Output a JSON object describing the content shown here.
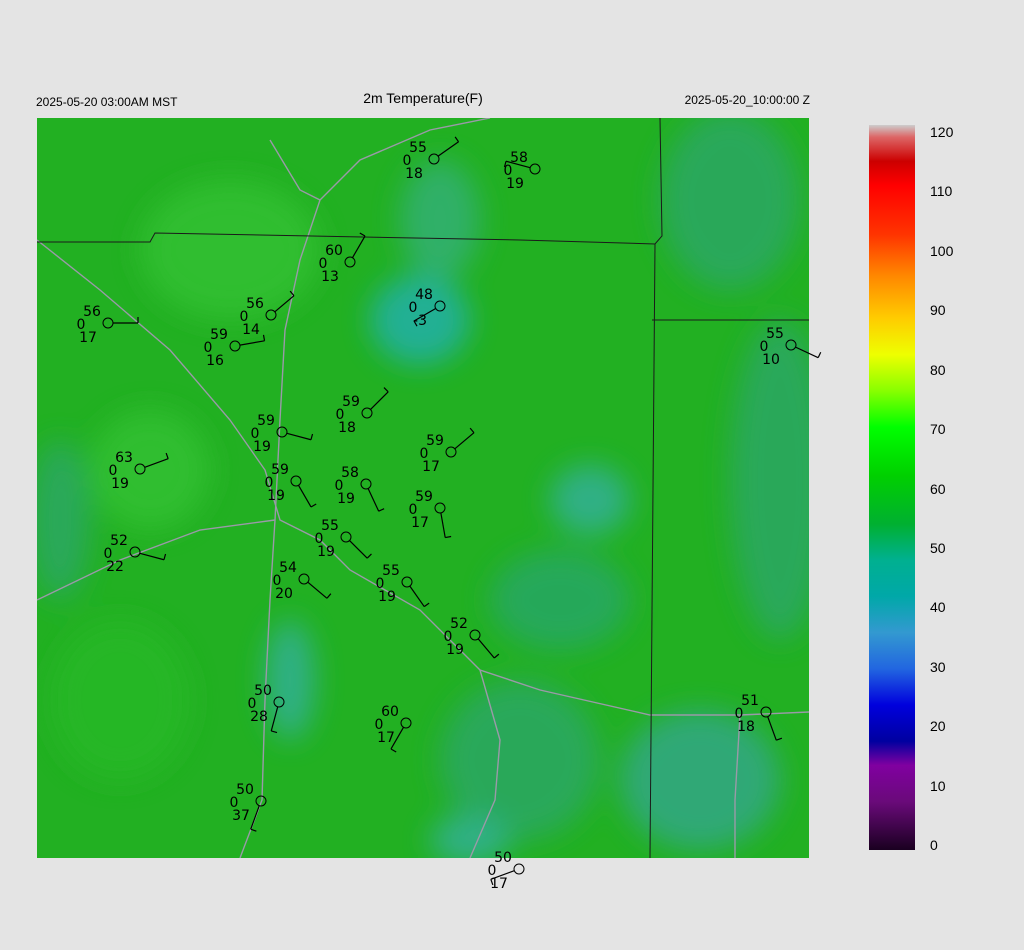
{
  "header": {
    "left": "2025-05-20 03:00AM MST",
    "title": "2m Temperature(F)",
    "right": "2025-05-20_10:00:00 Z"
  },
  "colorbar": {
    "labels": [
      "0",
      "10",
      "20",
      "30",
      "40",
      "50",
      "60",
      "70",
      "80",
      "90",
      "100",
      "110",
      "120"
    ],
    "range": [
      0,
      120
    ],
    "stops": [
      {
        "v": 0,
        "c": "#1a0020"
      },
      {
        "v": 8,
        "c": "#6a0a7a"
      },
      {
        "v": 14,
        "c": "#8000a0"
      },
      {
        "v": 18,
        "c": "#0000a0"
      },
      {
        "v": 24,
        "c": "#0000dd"
      },
      {
        "v": 30,
        "c": "#2266e0"
      },
      {
        "v": 36,
        "c": "#3399d0"
      },
      {
        "v": 42,
        "c": "#00a8a8"
      },
      {
        "v": 48,
        "c": "#00b090"
      },
      {
        "v": 54,
        "c": "#00b030"
      },
      {
        "v": 62,
        "c": "#00d000"
      },
      {
        "v": 70,
        "c": "#00ff00"
      },
      {
        "v": 76,
        "c": "#88ff00"
      },
      {
        "v": 82,
        "c": "#eeff00"
      },
      {
        "v": 88,
        "c": "#ffcc00"
      },
      {
        "v": 95,
        "c": "#ff8800"
      },
      {
        "v": 102,
        "c": "#ff3300"
      },
      {
        "v": 110,
        "c": "#ff0000"
      },
      {
        "v": 114,
        "c": "#cc0000"
      },
      {
        "v": 118,
        "c": "#dd6666"
      },
      {
        "v": 120,
        "c": "#cccccc"
      }
    ]
  },
  "colors": {
    "field_base": "#22b020",
    "cool_patch": "#20b090",
    "border": "#1a1a1a",
    "road": "#9090a0"
  },
  "stations": [
    {
      "t": "55",
      "p": "0",
      "d": "18"
    },
    {
      "t": "58",
      "p": "0",
      "d": "19"
    },
    {
      "t": "60",
      "p": "0",
      "d": "13"
    },
    {
      "t": "48",
      "p": "0",
      "d": "-3"
    },
    {
      "t": "56",
      "p": "0",
      "d": "14"
    },
    {
      "t": "56",
      "p": "0",
      "d": "17"
    },
    {
      "t": "59",
      "p": "0",
      "d": "16"
    },
    {
      "t": "55",
      "p": "0",
      "d": "10"
    },
    {
      "t": "59",
      "p": "0",
      "d": "18"
    },
    {
      "t": "59",
      "p": "0",
      "d": "19"
    },
    {
      "t": "59",
      "p": "0",
      "d": "17"
    },
    {
      "t": "63",
      "p": "0",
      "d": "19"
    },
    {
      "t": "59",
      "p": "0",
      "d": "19"
    },
    {
      "t": "58",
      "p": "0",
      "d": "19"
    },
    {
      "t": "59",
      "p": "0",
      "d": "17"
    },
    {
      "t": "52",
      "p": "0",
      "d": "22"
    },
    {
      "t": "55",
      "p": "0",
      "d": "19"
    },
    {
      "t": "54",
      "p": "0",
      "d": "20"
    },
    {
      "t": "55",
      "p": "0",
      "d": "19"
    },
    {
      "t": "52",
      "p": "0",
      "d": "19"
    },
    {
      "t": "50",
      "p": "0",
      "d": "28"
    },
    {
      "t": "60",
      "p": "0",
      "d": "17"
    },
    {
      "t": "51",
      "p": "0",
      "d": "18"
    },
    {
      "t": "50",
      "p": "0",
      "d": "37"
    },
    {
      "t": "50",
      "p": "0",
      "d": "17"
    }
  ]
}
